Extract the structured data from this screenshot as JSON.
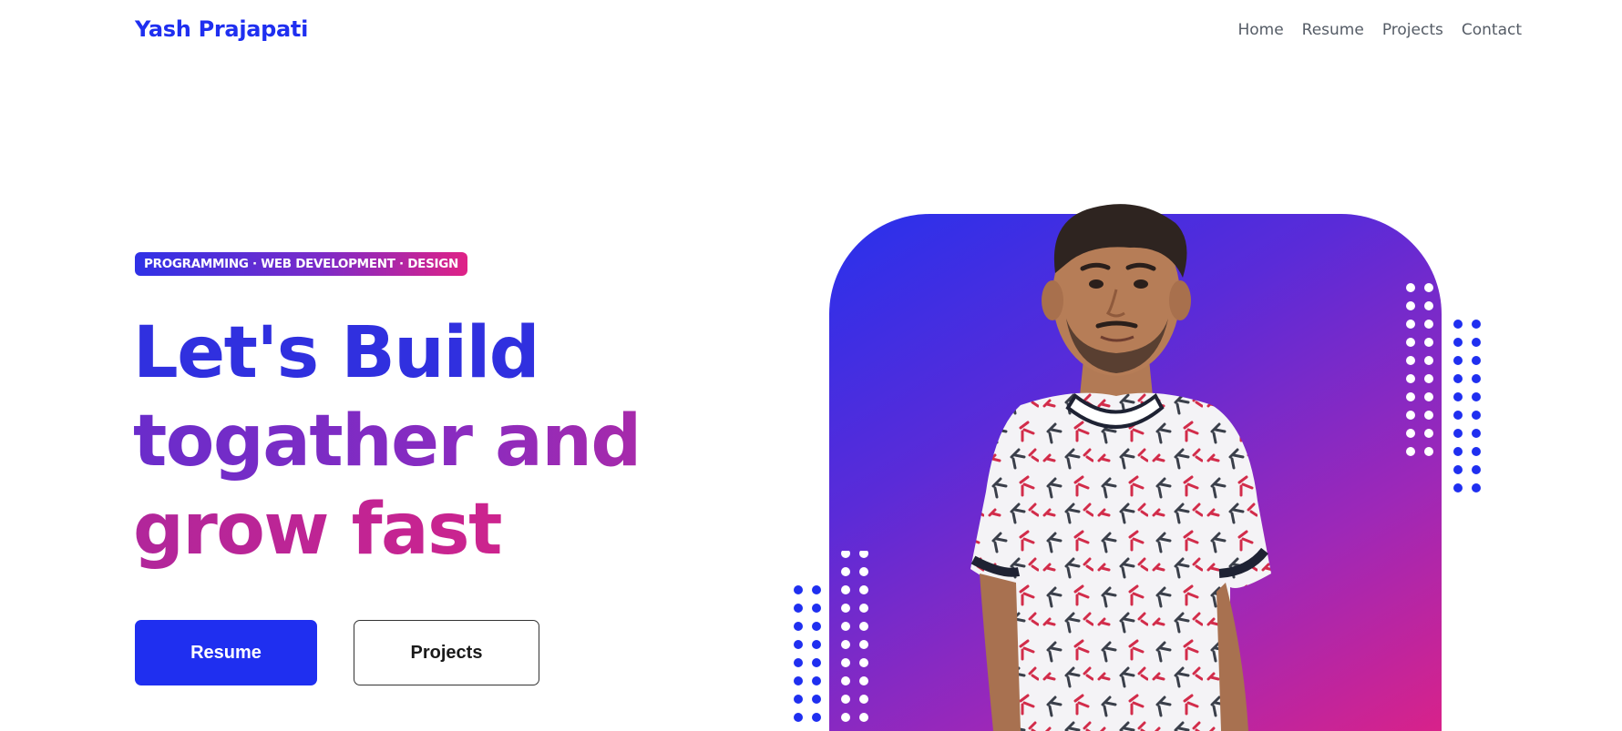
{
  "navbar": {
    "brand": "Yash Prajapati",
    "links": [
      {
        "label": "Home"
      },
      {
        "label": "Resume"
      },
      {
        "label": "Projects"
      },
      {
        "label": "Contact"
      }
    ]
  },
  "hero": {
    "badge": "PROGRAMMING · WEB DEVELOPMENT · DESIGN",
    "title_lines": [
      "Let's Build",
      "togather and",
      "grow fast"
    ],
    "buttons": {
      "resume": "Resume",
      "projects": "Projects"
    }
  },
  "colors": {
    "brand_blue": "#1f2ff0",
    "gradient_start": "#2831ec",
    "gradient_end": "#d8228a",
    "nav_text": "#555c66"
  },
  "icons": {
    "dot_pattern": "dot-grid-decoration"
  }
}
